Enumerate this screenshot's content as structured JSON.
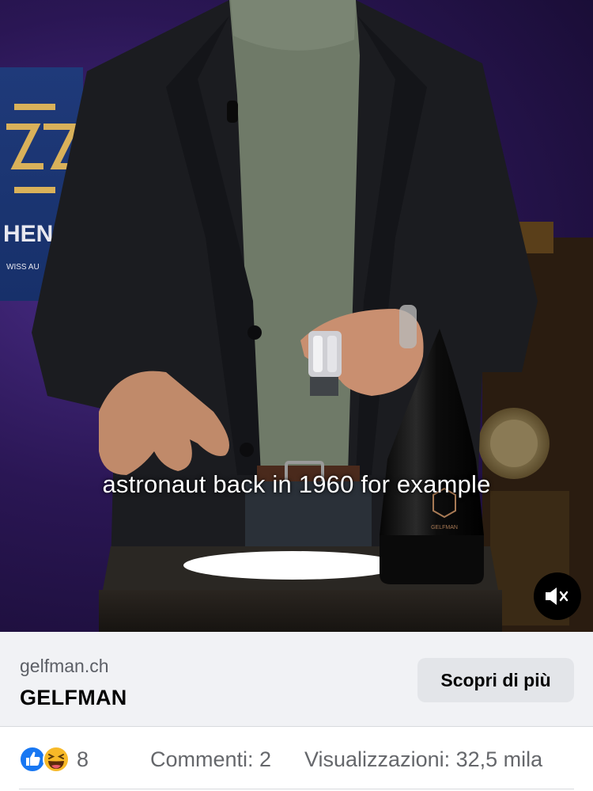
{
  "video": {
    "caption": "astronaut back in 1960 for example",
    "mute_label": "muted"
  },
  "link_preview": {
    "domain": "gelfman.ch",
    "title": "GELFMAN",
    "cta_label": "Scopri di più"
  },
  "stats": {
    "reaction_count": "8",
    "comments": "Commenti: 2",
    "views": "Visualizzazioni: 32,5 mila"
  },
  "colors": {
    "like_blue": "#1877f2",
    "haha_yellow": "#f7b928",
    "muted_text": "#65676b"
  },
  "icons": {
    "mute": "speaker-muted-icon",
    "like": "like-reaction-icon",
    "haha": "haha-reaction-icon"
  }
}
